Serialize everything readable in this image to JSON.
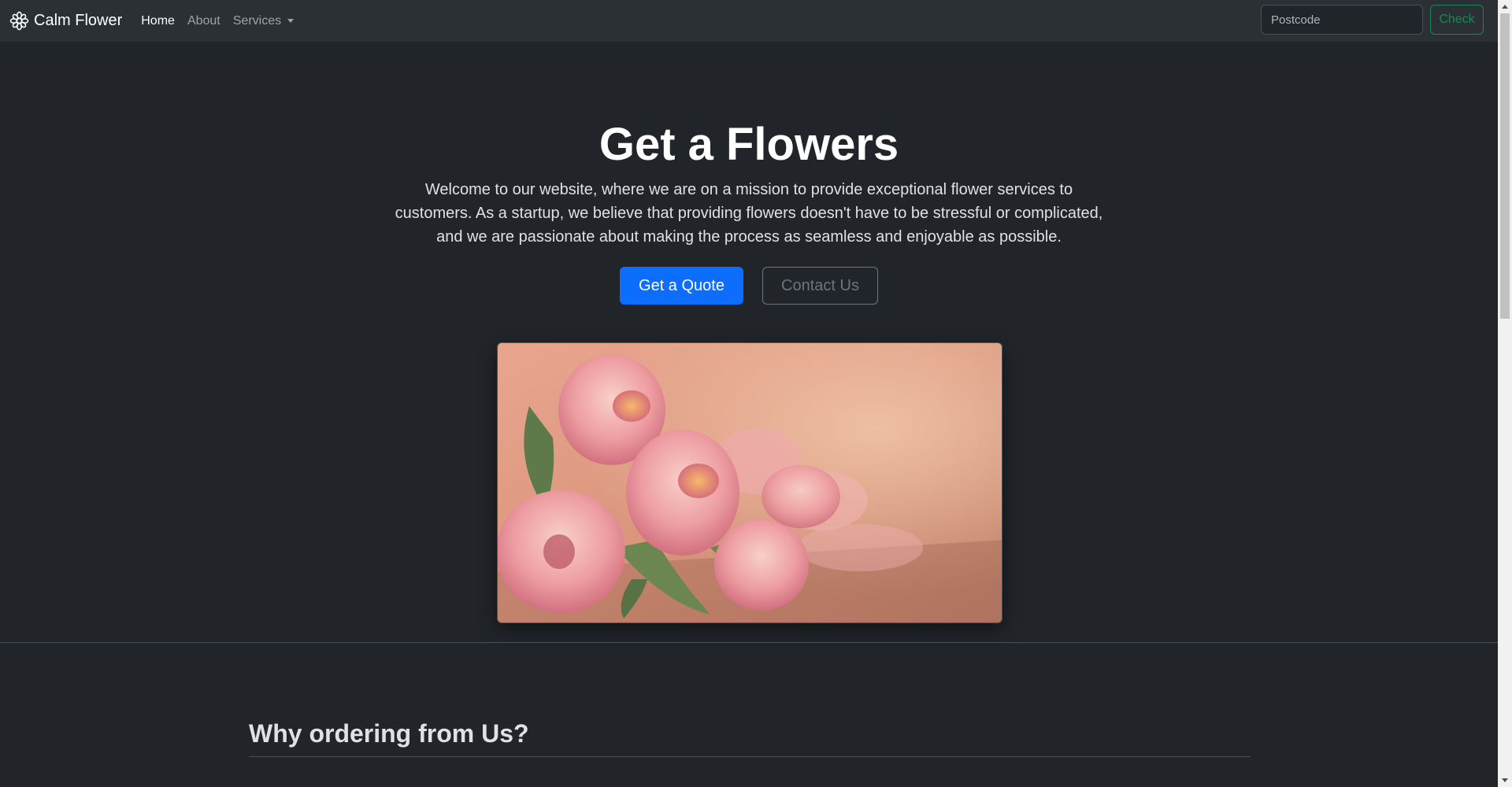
{
  "navbar": {
    "brand": "Calm Flower",
    "brand_icon": "flower-icon",
    "links": [
      {
        "label": "Home",
        "active": true
      },
      {
        "label": "About",
        "active": false
      },
      {
        "label": "Services",
        "active": false,
        "dropdown": true
      }
    ],
    "search": {
      "placeholder": "Postcode",
      "value": ""
    },
    "check_label": "Check"
  },
  "hero": {
    "title": "Get a Flowers",
    "text": "Welcome to our website, where we are on a mission to provide exceptional flower services to customers. As a startup, we believe that providing flowers doesn't have to be stressful or complicated, and we are passionate about making the process as seamless and enjoyable as possible.",
    "primary_button": "Get a Quote",
    "secondary_button": "Contact Us",
    "image_alt": "pink-tulips-bouquet"
  },
  "section": {
    "title": "Why ordering from Us?"
  },
  "colors": {
    "background": "#212529",
    "navbar": "#2b3035",
    "primary": "#0d6efd",
    "success": "#198754",
    "secondary": "#6c757d"
  }
}
